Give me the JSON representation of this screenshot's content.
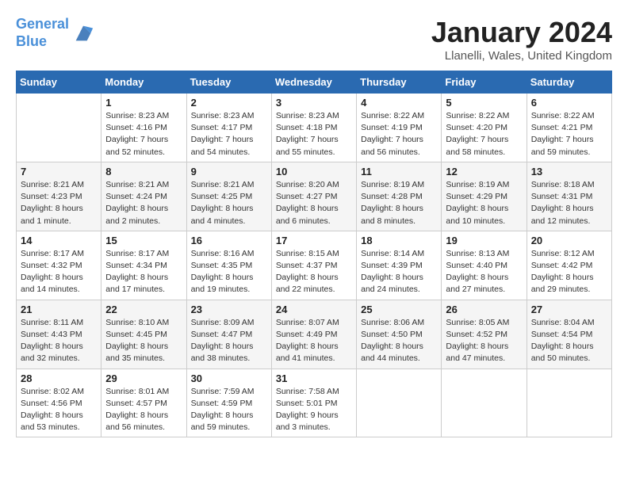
{
  "header": {
    "logo_line1": "General",
    "logo_line2": "Blue",
    "month_title": "January 2024",
    "location": "Llanelli, Wales, United Kingdom"
  },
  "days_of_week": [
    "Sunday",
    "Monday",
    "Tuesday",
    "Wednesday",
    "Thursday",
    "Friday",
    "Saturday"
  ],
  "weeks": [
    [
      {
        "day": "",
        "info": ""
      },
      {
        "day": "1",
        "info": "Sunrise: 8:23 AM\nSunset: 4:16 PM\nDaylight: 7 hours\nand 52 minutes."
      },
      {
        "day": "2",
        "info": "Sunrise: 8:23 AM\nSunset: 4:17 PM\nDaylight: 7 hours\nand 54 minutes."
      },
      {
        "day": "3",
        "info": "Sunrise: 8:23 AM\nSunset: 4:18 PM\nDaylight: 7 hours\nand 55 minutes."
      },
      {
        "day": "4",
        "info": "Sunrise: 8:22 AM\nSunset: 4:19 PM\nDaylight: 7 hours\nand 56 minutes."
      },
      {
        "day": "5",
        "info": "Sunrise: 8:22 AM\nSunset: 4:20 PM\nDaylight: 7 hours\nand 58 minutes."
      },
      {
        "day": "6",
        "info": "Sunrise: 8:22 AM\nSunset: 4:21 PM\nDaylight: 7 hours\nand 59 minutes."
      }
    ],
    [
      {
        "day": "7",
        "info": "Sunrise: 8:21 AM\nSunset: 4:23 PM\nDaylight: 8 hours\nand 1 minute."
      },
      {
        "day": "8",
        "info": "Sunrise: 8:21 AM\nSunset: 4:24 PM\nDaylight: 8 hours\nand 2 minutes."
      },
      {
        "day": "9",
        "info": "Sunrise: 8:21 AM\nSunset: 4:25 PM\nDaylight: 8 hours\nand 4 minutes."
      },
      {
        "day": "10",
        "info": "Sunrise: 8:20 AM\nSunset: 4:27 PM\nDaylight: 8 hours\nand 6 minutes."
      },
      {
        "day": "11",
        "info": "Sunrise: 8:19 AM\nSunset: 4:28 PM\nDaylight: 8 hours\nand 8 minutes."
      },
      {
        "day": "12",
        "info": "Sunrise: 8:19 AM\nSunset: 4:29 PM\nDaylight: 8 hours\nand 10 minutes."
      },
      {
        "day": "13",
        "info": "Sunrise: 8:18 AM\nSunset: 4:31 PM\nDaylight: 8 hours\nand 12 minutes."
      }
    ],
    [
      {
        "day": "14",
        "info": "Sunrise: 8:17 AM\nSunset: 4:32 PM\nDaylight: 8 hours\nand 14 minutes."
      },
      {
        "day": "15",
        "info": "Sunrise: 8:17 AM\nSunset: 4:34 PM\nDaylight: 8 hours\nand 17 minutes."
      },
      {
        "day": "16",
        "info": "Sunrise: 8:16 AM\nSunset: 4:35 PM\nDaylight: 8 hours\nand 19 minutes."
      },
      {
        "day": "17",
        "info": "Sunrise: 8:15 AM\nSunset: 4:37 PM\nDaylight: 8 hours\nand 22 minutes."
      },
      {
        "day": "18",
        "info": "Sunrise: 8:14 AM\nSunset: 4:39 PM\nDaylight: 8 hours\nand 24 minutes."
      },
      {
        "day": "19",
        "info": "Sunrise: 8:13 AM\nSunset: 4:40 PM\nDaylight: 8 hours\nand 27 minutes."
      },
      {
        "day": "20",
        "info": "Sunrise: 8:12 AM\nSunset: 4:42 PM\nDaylight: 8 hours\nand 29 minutes."
      }
    ],
    [
      {
        "day": "21",
        "info": "Sunrise: 8:11 AM\nSunset: 4:43 PM\nDaylight: 8 hours\nand 32 minutes."
      },
      {
        "day": "22",
        "info": "Sunrise: 8:10 AM\nSunset: 4:45 PM\nDaylight: 8 hours\nand 35 minutes."
      },
      {
        "day": "23",
        "info": "Sunrise: 8:09 AM\nSunset: 4:47 PM\nDaylight: 8 hours\nand 38 minutes."
      },
      {
        "day": "24",
        "info": "Sunrise: 8:07 AM\nSunset: 4:49 PM\nDaylight: 8 hours\nand 41 minutes."
      },
      {
        "day": "25",
        "info": "Sunrise: 8:06 AM\nSunset: 4:50 PM\nDaylight: 8 hours\nand 44 minutes."
      },
      {
        "day": "26",
        "info": "Sunrise: 8:05 AM\nSunset: 4:52 PM\nDaylight: 8 hours\nand 47 minutes."
      },
      {
        "day": "27",
        "info": "Sunrise: 8:04 AM\nSunset: 4:54 PM\nDaylight: 8 hours\nand 50 minutes."
      }
    ],
    [
      {
        "day": "28",
        "info": "Sunrise: 8:02 AM\nSunset: 4:56 PM\nDaylight: 8 hours\nand 53 minutes."
      },
      {
        "day": "29",
        "info": "Sunrise: 8:01 AM\nSunset: 4:57 PM\nDaylight: 8 hours\nand 56 minutes."
      },
      {
        "day": "30",
        "info": "Sunrise: 7:59 AM\nSunset: 4:59 PM\nDaylight: 8 hours\nand 59 minutes."
      },
      {
        "day": "31",
        "info": "Sunrise: 7:58 AM\nSunset: 5:01 PM\nDaylight: 9 hours\nand 3 minutes."
      },
      {
        "day": "",
        "info": ""
      },
      {
        "day": "",
        "info": ""
      },
      {
        "day": "",
        "info": ""
      }
    ]
  ]
}
